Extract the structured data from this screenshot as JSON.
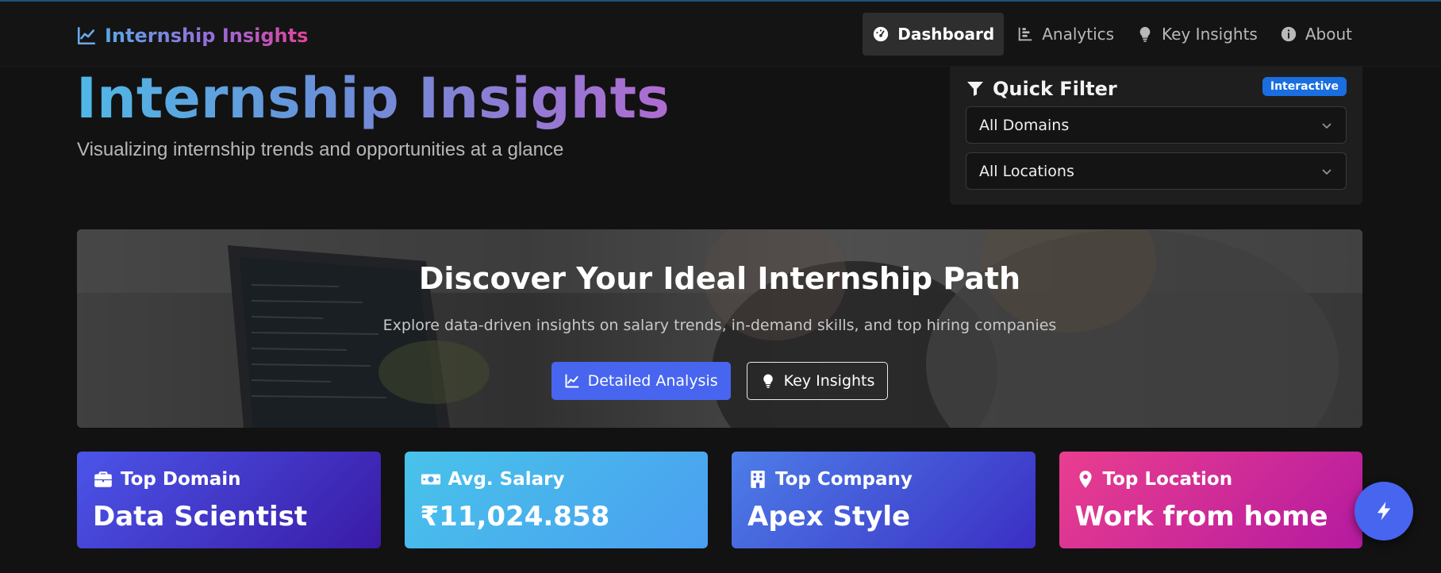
{
  "brand": {
    "name": "Internship Insights"
  },
  "nav": {
    "items": [
      {
        "label": "Dashboard",
        "icon": "gauge-icon",
        "active": true
      },
      {
        "label": "Analytics",
        "icon": "bar-chart-icon",
        "active": false
      },
      {
        "label": "Key Insights",
        "icon": "lightbulb-icon",
        "active": false
      },
      {
        "label": "About",
        "icon": "info-icon",
        "active": false
      }
    ]
  },
  "hero": {
    "title": "Internship Insights",
    "subtitle": "Visualizing internship trends and opportunities at a glance"
  },
  "filter": {
    "title": "Quick Filter",
    "badge": "Interactive",
    "domain_value": "All Domains",
    "location_value": "All Locations"
  },
  "banner": {
    "title": "Discover Your Ideal Internship Path",
    "subtitle": "Explore data-driven insights on salary trends, in-demand skills, and top hiring companies",
    "primary_button": "Detailed Analysis",
    "secondary_button": "Key Insights"
  },
  "stats": [
    {
      "label": "Top Domain",
      "value": "Data Scientist",
      "icon": "briefcase-icon"
    },
    {
      "label": "Avg. Salary",
      "value": "₹11,024.858",
      "icon": "money-icon"
    },
    {
      "label": "Top Company",
      "value": "Apex Style",
      "icon": "building-icon"
    },
    {
      "label": "Top Location",
      "value": "Work from home",
      "icon": "map-pin-icon"
    }
  ],
  "colors": {
    "background": "#121212",
    "accent": "#4765ef",
    "badge": "#1a6ee0"
  }
}
